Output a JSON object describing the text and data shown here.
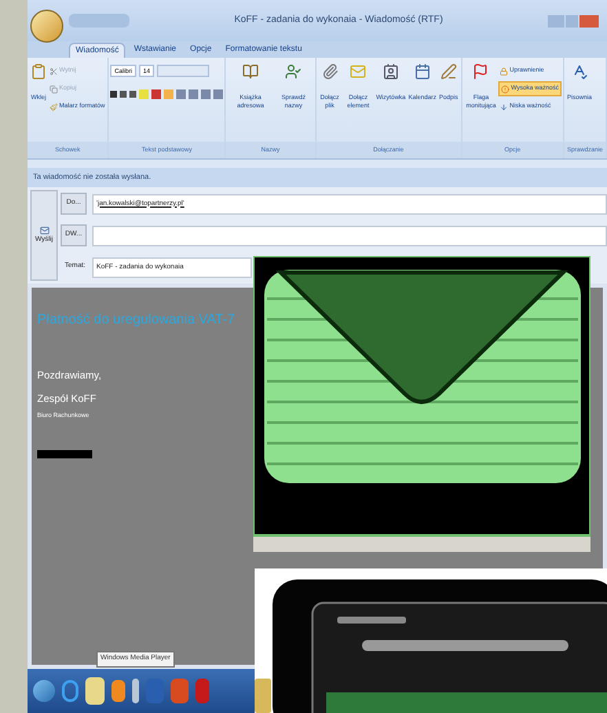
{
  "window": {
    "title": "KoFF - zadania do wykonaia - Wiadomość (RTF)"
  },
  "tabs": [
    {
      "label": "Wiadomość",
      "selected": true
    },
    {
      "label": "Wstawianie",
      "selected": false
    },
    {
      "label": "Opcje",
      "selected": false
    },
    {
      "label": "Formatowanie tekstu",
      "selected": false
    }
  ],
  "ribbon": [
    {
      "label": "Schowek",
      "items": [
        {
          "kind": "large",
          "label": "Wklej"
        },
        {
          "kind": "small",
          "label": "Wytnij",
          "disabled": true
        },
        {
          "kind": "small",
          "label": "Kopiuj",
          "disabled": true
        },
        {
          "kind": "small",
          "label": "Malarz formatów",
          "disabled": false
        }
      ]
    },
    {
      "label": "Tekst podstawowy",
      "items": [
        {
          "kind": "field",
          "label": "Calibri"
        },
        {
          "kind": "field",
          "label": "14"
        },
        {
          "kind": "tools"
        }
      ]
    },
    {
      "label": "Nazwy",
      "items": [
        {
          "kind": "large",
          "label": "Książka adresowa"
        },
        {
          "kind": "large",
          "label": "Sprawdź nazwy"
        }
      ]
    },
    {
      "label": "Dołączanie",
      "items": [
        {
          "kind": "large",
          "label": "Dołącz plik"
        },
        {
          "kind": "large",
          "label": "Dołącz element"
        },
        {
          "kind": "large",
          "label": "Wizytówka"
        },
        {
          "kind": "large",
          "label": "Kalendarz"
        },
        {
          "kind": "large",
          "label": "Podpis"
        }
      ]
    },
    {
      "label": "Opcje",
      "items": [
        {
          "kind": "large",
          "label": "Flaga monitująca"
        },
        {
          "kind": "small",
          "label": "Uprawnienie",
          "active": false
        },
        {
          "kind": "small",
          "label": "Wysoka ważność",
          "active": true
        },
        {
          "kind": "small",
          "label": "Niska ważność",
          "active": false
        }
      ]
    },
    {
      "label": "Sprawdzanie",
      "items": [
        {
          "kind": "large",
          "label": "Pisownia"
        }
      ]
    }
  ],
  "info_bar": "Ta wiadomość nie została wysłana.",
  "send_button": "Wyślij",
  "fields": [
    {
      "kind": "button",
      "label": "Do...",
      "value": "'jan.kowalski@topartnerzy.pl'"
    },
    {
      "kind": "button",
      "label": "DW..."
    },
    {
      "kind": "label",
      "label": "Temat:",
      "value": "KoFF - zadania do wykonaia"
    }
  ],
  "body": {
    "heading": "Płatność do uregulowania VAT-7",
    "lines": [
      "Pozdrawiamy,",
      "Zespół KoFF"
    ],
    "note": "Biuro Rachunkowe"
  },
  "taskbar": {
    "tooltip": "Windows Media Player"
  }
}
